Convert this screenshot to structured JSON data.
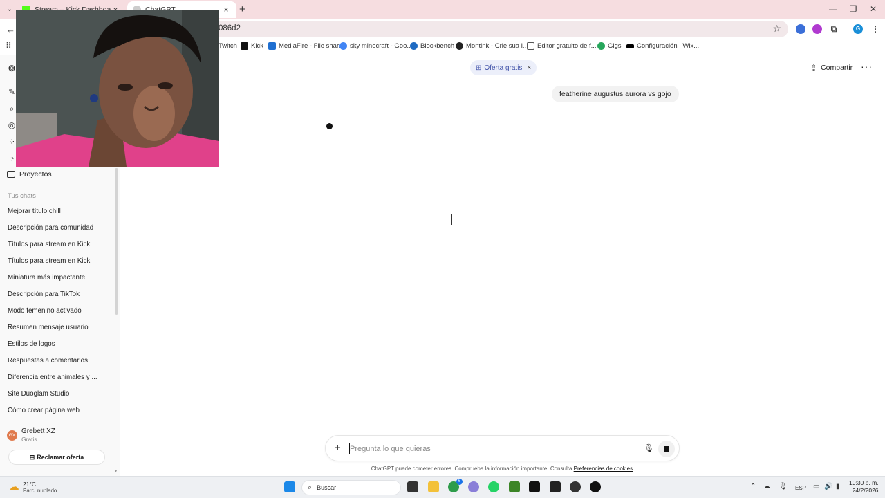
{
  "browser": {
    "tabs": [
      {
        "title": "Stream – Kick Dashboard",
        "active": false
      },
      {
        "title": "ChatGPT",
        "active": true
      }
    ],
    "address_url": "086d2",
    "bookmarks": [
      {
        "label": "Twitch",
        "color": "#9146ff"
      },
      {
        "label": "Kick",
        "color": "#53fc18"
      },
      {
        "label": "MediaFire - File shar...",
        "color": "#1f6fd1"
      },
      {
        "label": "sky minecraft - Goo...",
        "color": "#4285f4"
      },
      {
        "label": "Blockbench",
        "color": "#1e6ac2"
      },
      {
        "label": "Montink - Crie sua l...",
        "color": "#222222"
      },
      {
        "label": "Editor gratuito de f...",
        "color": "#555555"
      },
      {
        "label": "Gigs",
        "color": "#26a65b"
      },
      {
        "label": "Configuración | Wix...",
        "color": "#000000"
      }
    ],
    "profile_initial": "G"
  },
  "sidebar": {
    "projects_label": "Proyectos",
    "section_title": "Tus chats",
    "chats": [
      "Mejorar título chill",
      "Descripción para comunidad",
      "Títulos para stream en Kick",
      "Títulos para stream en Kick",
      "Miniatura más impactante",
      "Descripción para TikTok",
      "Modo femenino activado",
      "Resumen mensaje usuario",
      "Estilos de logos",
      "Respuestas a comentarios",
      "Diferencia entre animales y ...",
      "Site Duoglam Studio",
      "Cómo crear página web"
    ],
    "user": {
      "initials": "GX",
      "name": "Grebett XZ",
      "plan": "Gratis"
    },
    "claim_offer": "Reclamar oferta"
  },
  "main": {
    "offer_badge": "Oferta gratis",
    "share_label": "Compartir",
    "user_message": "featherine augustus aurora vs gojo",
    "composer_placeholder": "Pregunta lo que quieras",
    "disclaimer_text": "ChatGPT puede cometer errores. Comprueba la información importante. Consulta",
    "disclaimer_link": "Preferencias de cookies",
    "disclaimer_end": "."
  },
  "taskbar": {
    "temperature": "21°C",
    "weather_desc": "Parc. nublado",
    "search_label": "Buscar",
    "language": "ESP",
    "time": "10:30 p. m.",
    "date": "24/2/2026",
    "chrome_badge": "6"
  },
  "colors": {
    "tabbar_bg": "#f6dde0",
    "sidebar_bg": "#f9f9f9",
    "offer_text": "#4455aa",
    "webcam_shirt": "#e0418a"
  }
}
